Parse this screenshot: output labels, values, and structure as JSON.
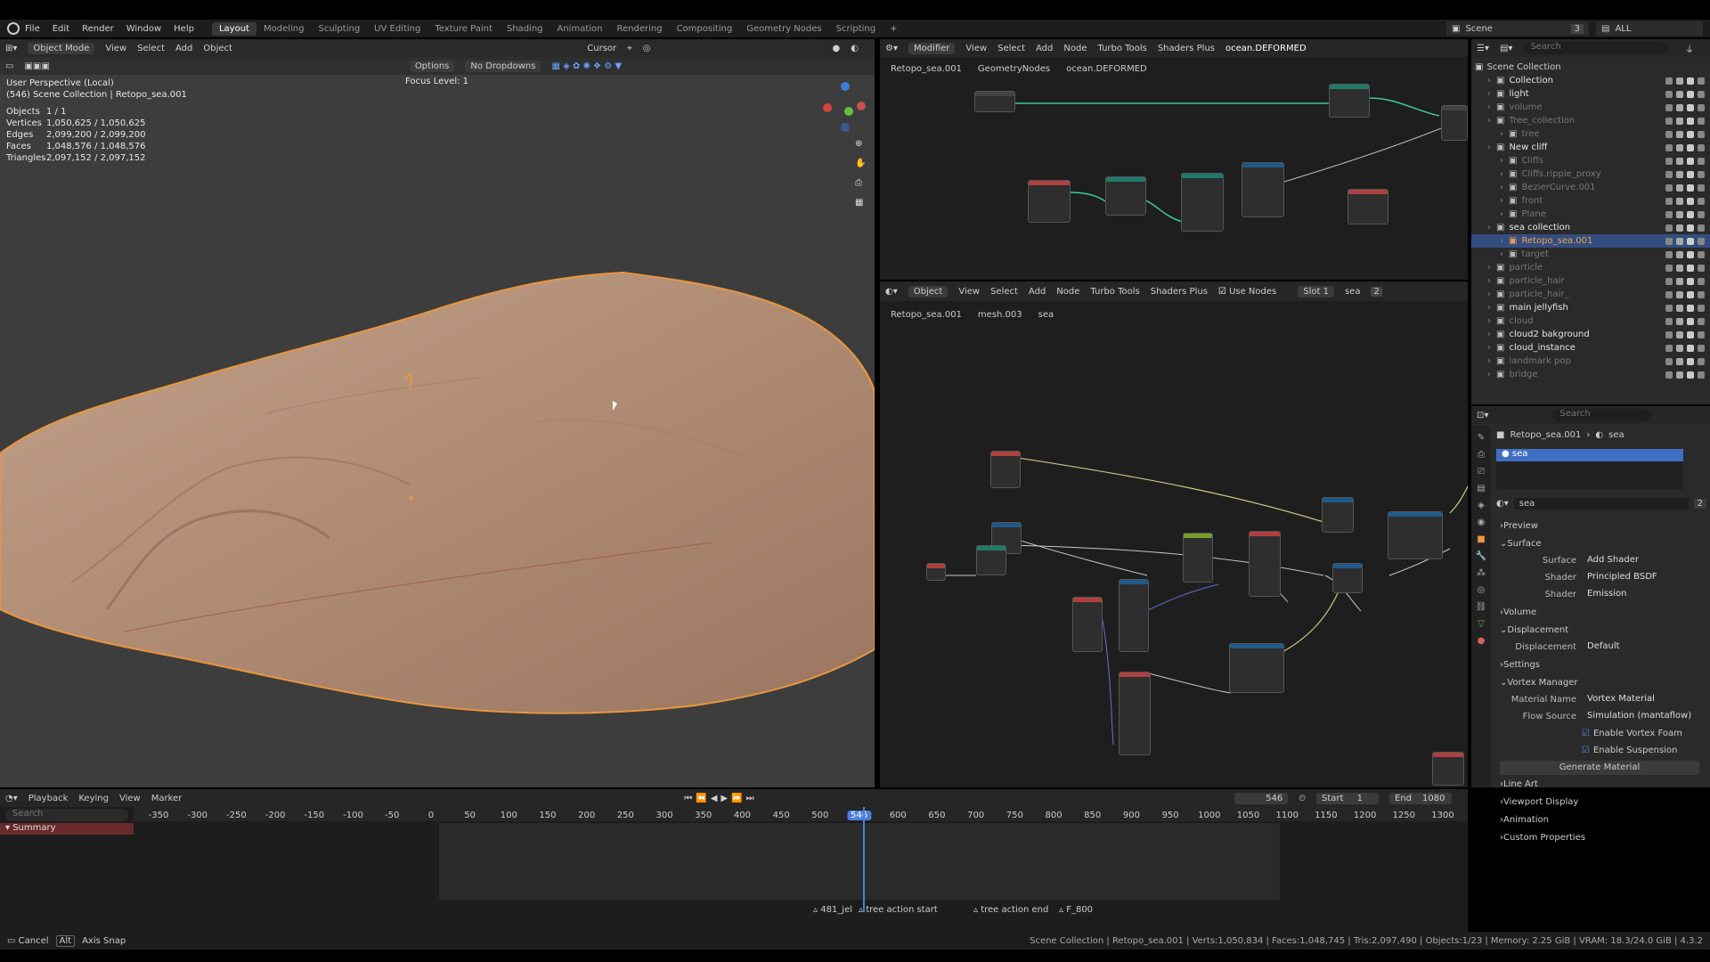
{
  "menu": {
    "items": [
      "File",
      "Edit",
      "Render",
      "Window",
      "Help"
    ]
  },
  "workspaces": [
    "Layout",
    "Modeling",
    "Sculpting",
    "UV Editing",
    "Texture Paint",
    "Shading",
    "Animation",
    "Rendering",
    "Compositing",
    "Geometry Nodes",
    "Scripting"
  ],
  "active_workspace": "Layout",
  "top_right": {
    "scene_label": "Scene",
    "scene_count": "3",
    "view_layer": "ALL"
  },
  "viewport": {
    "mode": "Object Mode",
    "menus": [
      "View",
      "Select",
      "Add",
      "Object"
    ],
    "pivot": "Cursor",
    "options": "Options",
    "dropdown": "No Dropdowns",
    "focus": "Focus Level: 1",
    "info_title": "User Perspective (Local)",
    "info_sub": "(546) Scene Collection | Retopo_sea.001",
    "stats": [
      {
        "k": "Objects",
        "v": "1 / 1"
      },
      {
        "k": "Vertices",
        "v": "1,050,625 / 1,050,625"
      },
      {
        "k": "Edges",
        "v": "2,099,200 / 2,099,200"
      },
      {
        "k": "Faces",
        "v": "1,048,576 / 1,048,576"
      },
      {
        "k": "Triangles",
        "v": "2,097,152 / 2,097,152"
      }
    ]
  },
  "geo_nodes": {
    "editor_type": "Modifier",
    "menus": [
      "View",
      "Select",
      "Add",
      "Node",
      "Turbo Tools",
      "Shaders Plus"
    ],
    "tree_name": "ocean.DEFORMED",
    "breadcrumb": [
      "Retopo_sea.001",
      "GeometryNodes",
      "ocean.DEFORMED"
    ]
  },
  "shader_nodes": {
    "editor_type": "Object",
    "menus": [
      "View",
      "Select",
      "Add",
      "Node",
      "Turbo Tools",
      "Shaders Plus"
    ],
    "use_nodes": "Use Nodes",
    "slot": "Slot 1",
    "material": "sea",
    "users": "2",
    "breadcrumb": [
      "Retopo_sea.001",
      "mesh.003",
      "sea"
    ]
  },
  "outliner": {
    "search_placeholder": "Search",
    "root": "Scene Collection",
    "items": [
      {
        "label": "Collection",
        "indent": 1,
        "color": "#e6e6e6"
      },
      {
        "label": "light",
        "indent": 1,
        "color": "#e6e6e6"
      },
      {
        "label": "volume",
        "indent": 1,
        "color": "#777"
      },
      {
        "label": "Tree_collection",
        "indent": 1,
        "color": "#777"
      },
      {
        "label": "tree",
        "indent": 2,
        "color": "#777"
      },
      {
        "label": "New cliff",
        "indent": 1,
        "color": "#e6e6e6"
      },
      {
        "label": "Cliffs",
        "indent": 2,
        "color": "#777"
      },
      {
        "label": "Cliffs.ripple_proxy",
        "indent": 2,
        "color": "#777"
      },
      {
        "label": "BezierCurve.001",
        "indent": 2,
        "color": "#777"
      },
      {
        "label": "front",
        "indent": 2,
        "color": "#777"
      },
      {
        "label": "Plane",
        "indent": 2,
        "color": "#777"
      },
      {
        "label": "sea collection",
        "indent": 1,
        "color": "#e6e6e6"
      },
      {
        "label": "Retopo_sea.001",
        "indent": 2,
        "color": "#f0a050",
        "selected": true
      },
      {
        "label": "target",
        "indent": 2,
        "color": "#777"
      },
      {
        "label": "particle",
        "indent": 1,
        "color": "#777"
      },
      {
        "label": "particle_hair",
        "indent": 1,
        "color": "#777"
      },
      {
        "label": "particle_hair_",
        "indent": 1,
        "color": "#777"
      },
      {
        "label": "main jellyfish",
        "indent": 1,
        "color": "#e6e6e6"
      },
      {
        "label": "cloud",
        "indent": 1,
        "color": "#777"
      },
      {
        "label": "cloud2 bakground",
        "indent": 1,
        "color": "#e6e6e6"
      },
      {
        "label": "cloud_instance",
        "indent": 1,
        "color": "#e6e6e6"
      },
      {
        "label": "landmark pop",
        "indent": 1,
        "color": "#777"
      },
      {
        "label": "bridge",
        "indent": 1,
        "color": "#777"
      }
    ]
  },
  "properties": {
    "search_placeholder": "Search",
    "breadcrumb_object": "Retopo_sea.001",
    "breadcrumb_material": "sea",
    "slot_name": "sea",
    "material_name": "sea",
    "material_users": "2",
    "sections": {
      "preview": "Preview",
      "surface": "Surface",
      "volume": "Volume",
      "displacement": "Displacement",
      "settings": "Settings",
      "vortex": "Vortex Manager",
      "line_art": "Line Art",
      "viewport_display": "Viewport Display",
      "animation": "Animation",
      "custom": "Custom Properties"
    },
    "surface_rows": [
      {
        "label": "Surface",
        "value": "Add Shader"
      },
      {
        "label": "Shader",
        "value": "Principled BSDF"
      },
      {
        "label": "Shader",
        "value": "Emission"
      }
    ],
    "displacement_row": {
      "label": "Displacement",
      "value": "Default"
    },
    "vortex": {
      "material_name_label": "Material Name",
      "material_name": "Vortex Material",
      "flow_source_label": "Flow Source",
      "flow_source": "Simulation (mantaflow)",
      "foam": "Enable Vortex Foam",
      "suspension": "Enable Suspension",
      "generate": "Generate Material"
    }
  },
  "timeline": {
    "menus": [
      "Playback",
      "Keying",
      "View",
      "Marker"
    ],
    "current_frame": "546",
    "start_label": "Start",
    "start": "1",
    "end_label": "End",
    "end": "1080",
    "search_placeholder": "Search",
    "summary": "Summary",
    "ruler": [
      "-350",
      "-300",
      "-250",
      "-200",
      "-150",
      "-100",
      "-50",
      "0",
      "50",
      "100",
      "150",
      "200",
      "250",
      "300",
      "350",
      "400",
      "450",
      "500",
      "546",
      "600",
      "650",
      "700",
      "750",
      "800",
      "850",
      "900",
      "950",
      "1000",
      "1050",
      "1100",
      "1150",
      "1200",
      "1250",
      "1300"
    ],
    "markers": [
      "481_jel",
      "tree action start",
      "tree action end",
      "F_800"
    ]
  },
  "statusbar": {
    "cancel": "Cancel",
    "alt": "Alt",
    "axis_snap": "Axis Snap",
    "info": "Scene Collection | Retopo_sea.001 | Verts:1,050,834 | Faces:1,048,745 | Tris:2,097,490 | Objects:1/23 | Memory: 2.25 GiB | VRAM: 18.3/24.0 GiB | 4.3.2"
  }
}
